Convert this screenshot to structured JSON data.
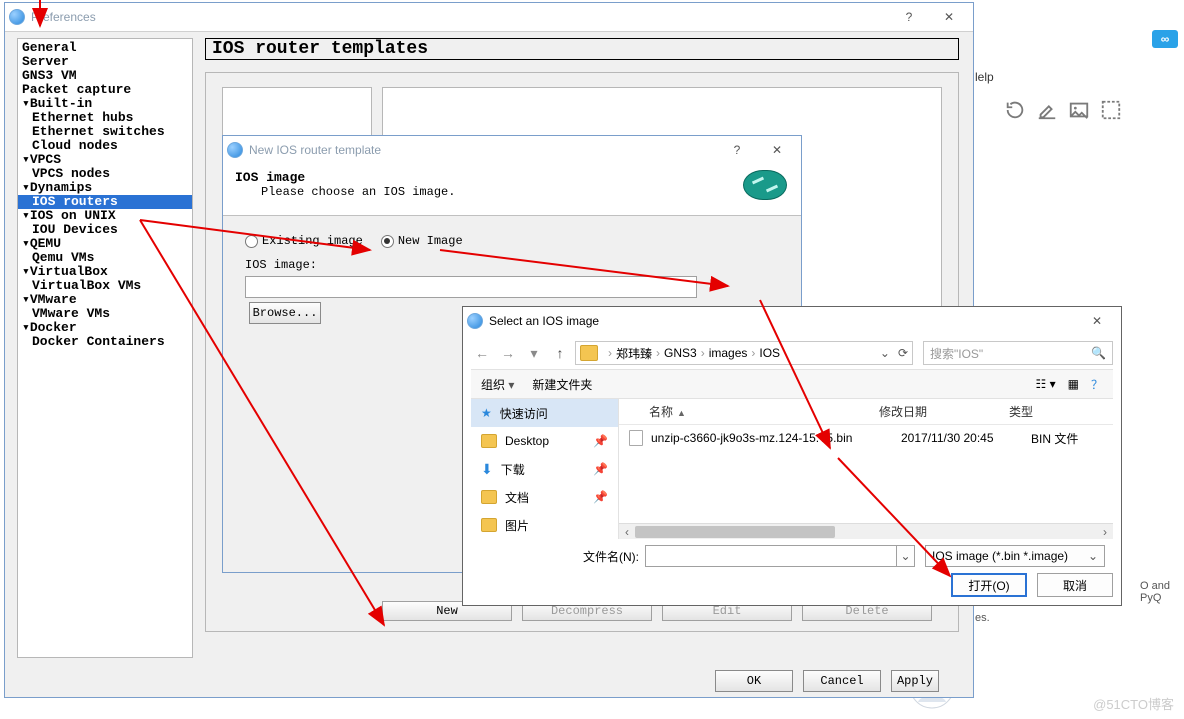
{
  "bg": {
    "help_menu": "lelp",
    "note_right": "O and PyQ",
    "note_right2": "es.",
    "watermark": "@51CTO博客"
  },
  "prefs": {
    "title": "Preferences",
    "section_title": "IOS router templates",
    "tree": {
      "general": "General",
      "server": "Server",
      "gns3vm": "GNS3 VM",
      "packet_capture": "Packet capture",
      "builtin": "▾Built-in",
      "ethernet_hubs": "Ethernet hubs",
      "ethernet_switches": "Ethernet switches",
      "cloud_nodes": "Cloud nodes",
      "vpcs": "▾VPCS",
      "vpcs_nodes": "VPCS nodes",
      "dynamips": "▾Dynamips",
      "ios_routers": "IOS routers",
      "ios_on_unix": "▾IOS on UNIX",
      "iou_devices": "IOU Devices",
      "qemu": "▾QEMU",
      "qemu_vms": "Qemu VMs",
      "virtualbox": "▾VirtualBox",
      "virtualbox_vms": "VirtualBox VMs",
      "vmware": "▾VMware",
      "vmware_vms": "VMware VMs",
      "docker": "▾Docker",
      "docker_containers": "Docker Containers"
    },
    "buttons": {
      "new": "New",
      "decompress": "Decompress",
      "edit": "Edit",
      "delete": "Delete",
      "ok": "OK",
      "cancel": "Cancel",
      "apply": "Apply"
    }
  },
  "wizard": {
    "title": "New IOS router template",
    "head1": "IOS image",
    "head2": "Please choose an IOS image.",
    "existing": "Existing image",
    "new_image": "New Image",
    "ios_image_label": "IOS image:",
    "browse": "Browse..."
  },
  "fc": {
    "title": "Select an IOS image",
    "crumbs": {
      "c1": "郑玮臻",
      "c2": "GNS3",
      "c3": "images",
      "c4": "IOS"
    },
    "search_placeholder": "搜索\"IOS\"",
    "organize": "组织",
    "new_folder": "新建文件夹",
    "view_label": "",
    "side": {
      "quick": "快速访问",
      "desktop": "Desktop",
      "downloads": "下载",
      "documents": "文档",
      "pictures": "图片"
    },
    "header": {
      "name": "名称",
      "date": "修改日期",
      "type": "类型"
    },
    "file": {
      "name": "unzip-c3660-jk9o3s-mz.124-15.T5.bin",
      "date": "2017/11/30 20:45",
      "type": "BIN 文件"
    },
    "fn_label": "文件名(N):",
    "filter": "IOS image (*.bin *.image)",
    "open": "打开(O)",
    "cancel": "取消"
  }
}
